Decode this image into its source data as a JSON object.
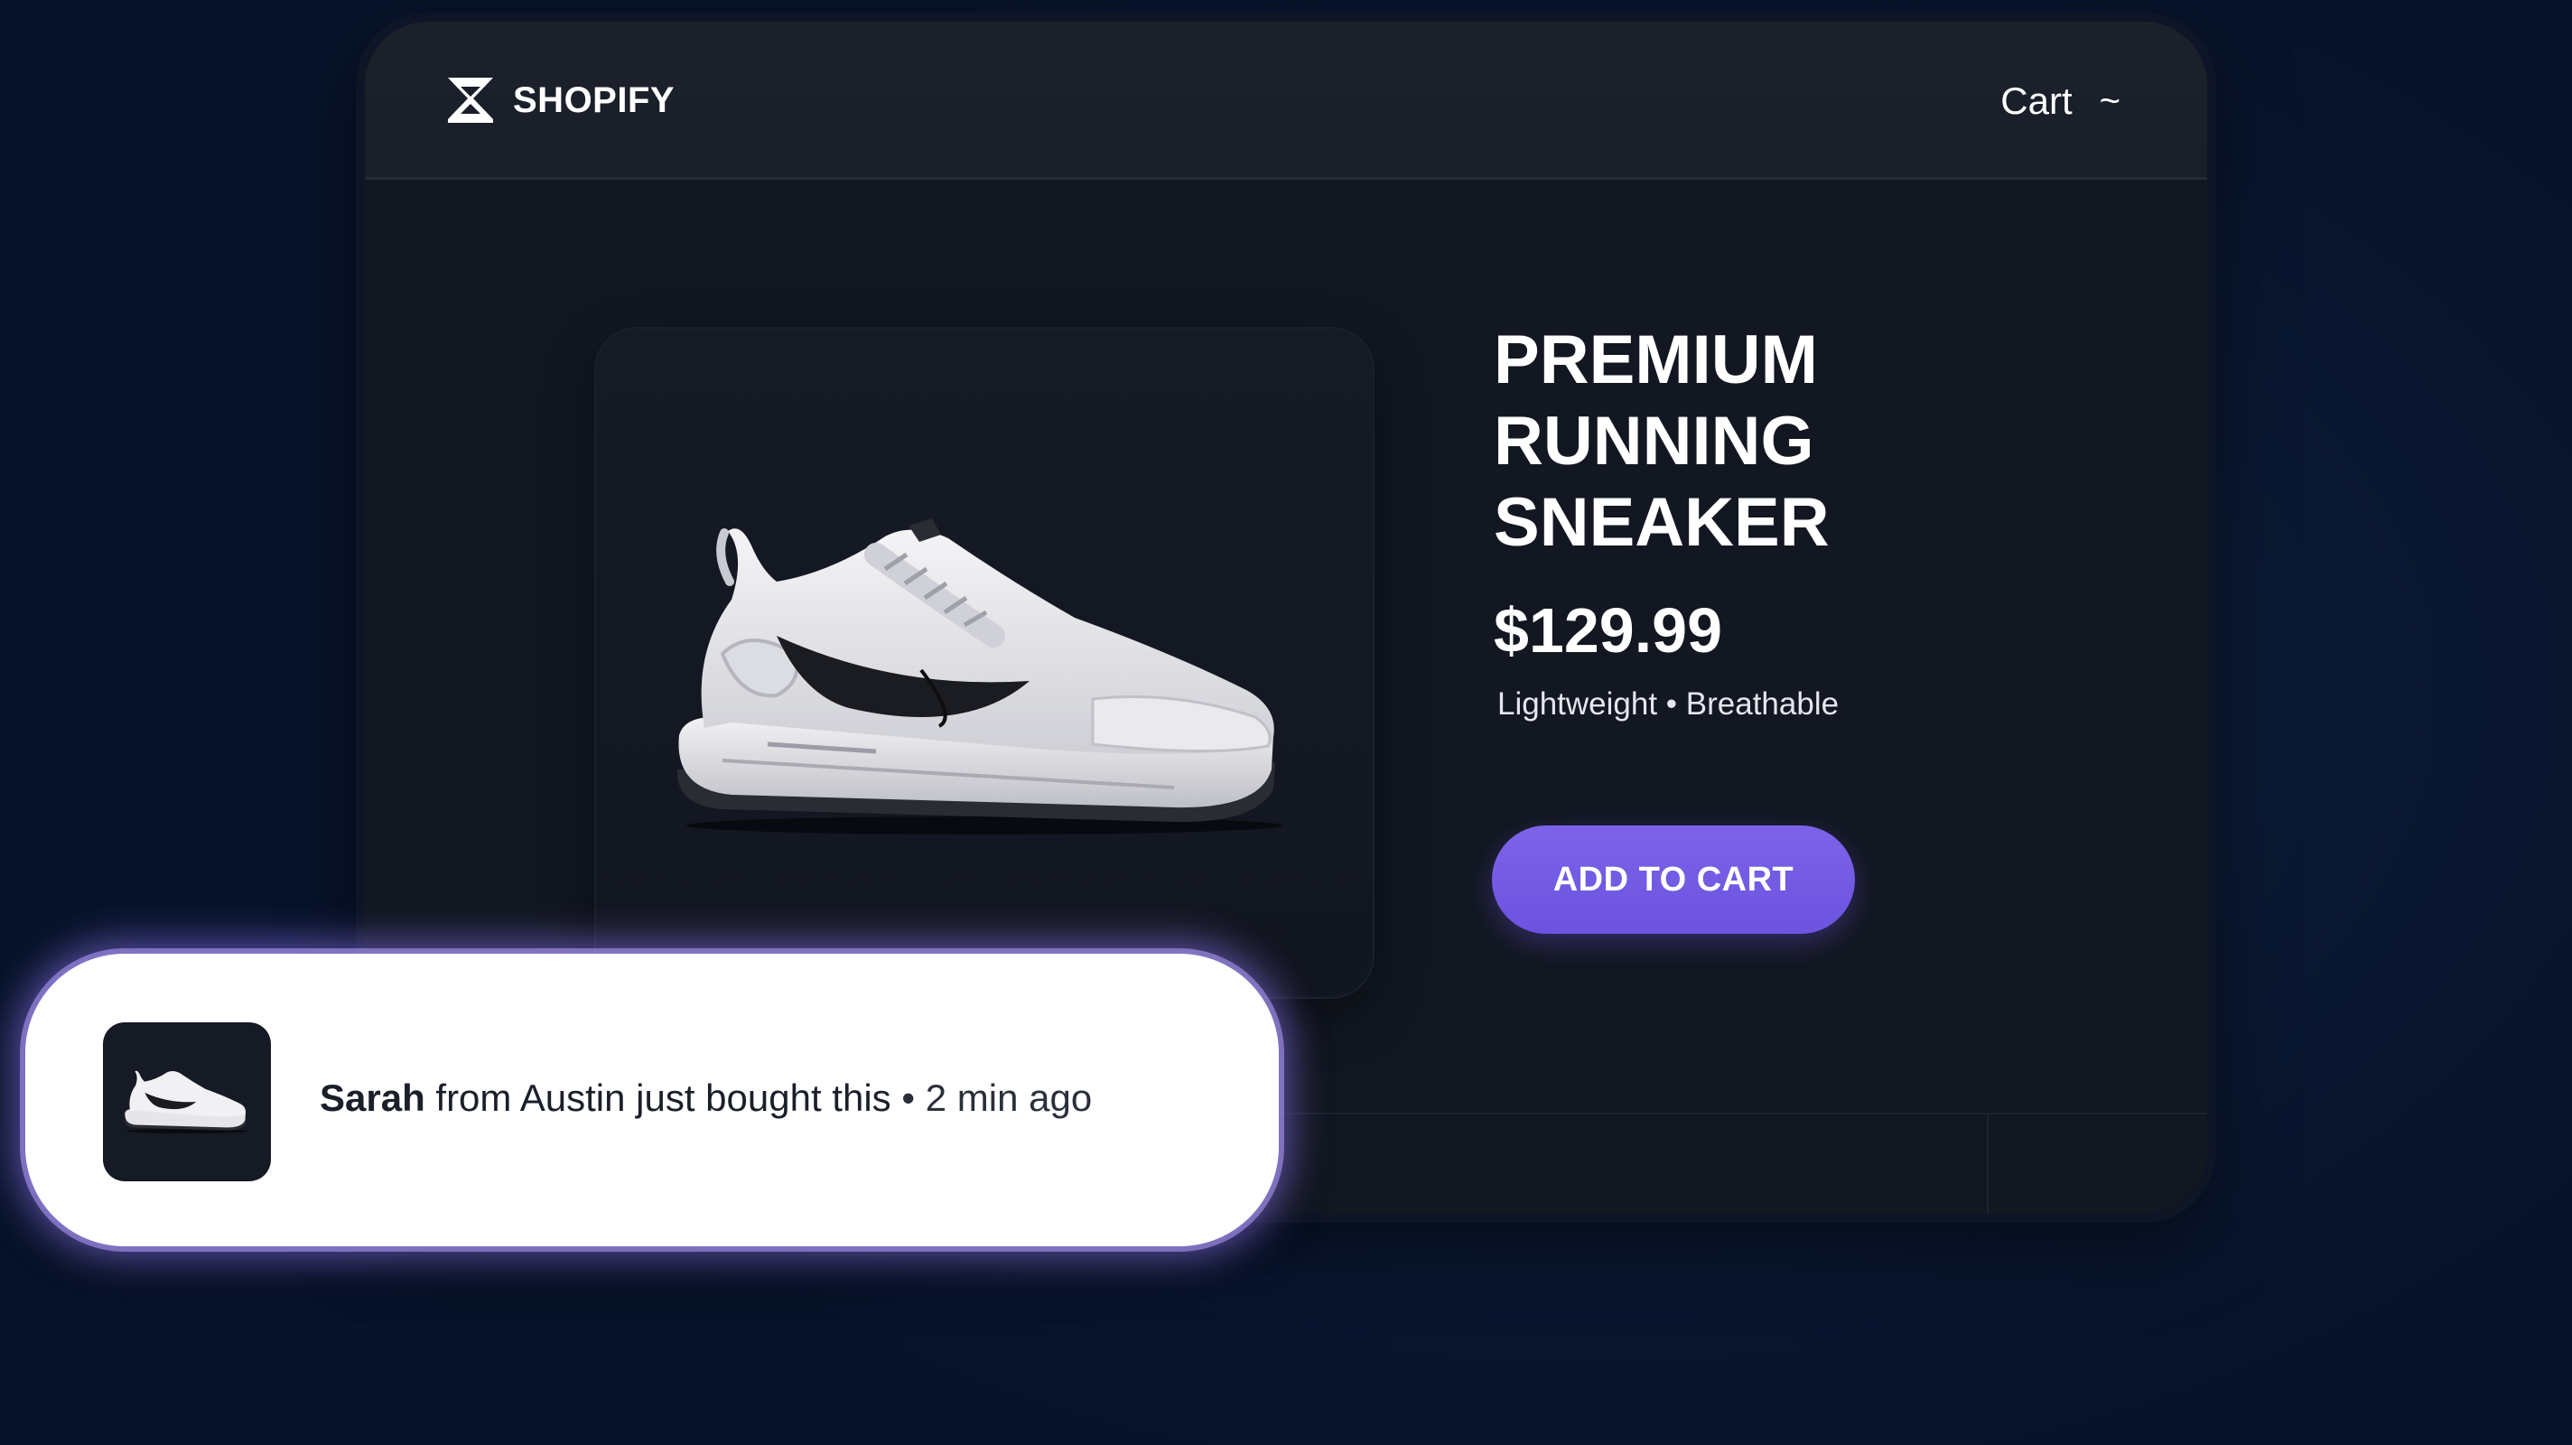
{
  "header": {
    "brand": "SHOPIFY",
    "brand_icon": "shopify-logo-icon",
    "cart_label": "Cart",
    "cart_caret": "~"
  },
  "product": {
    "image": "white-running-sneaker",
    "title": "PREMIUM RUNNING SNEAKER",
    "price": "$129.99",
    "tags": "Lightweight • Breathable",
    "cta_label": "ADD TO CART"
  },
  "notification": {
    "thumbnail": "sneaker-thumbnail",
    "name": "Sarah",
    "message": " from Austin just bought this ",
    "separator": "•",
    "time": " 2 min ago"
  },
  "colors": {
    "accent": "#6c53e0",
    "background": "#0c1a35",
    "window": "#121721",
    "toast": "#ffffff",
    "toast_glow": "#9b82ff"
  }
}
